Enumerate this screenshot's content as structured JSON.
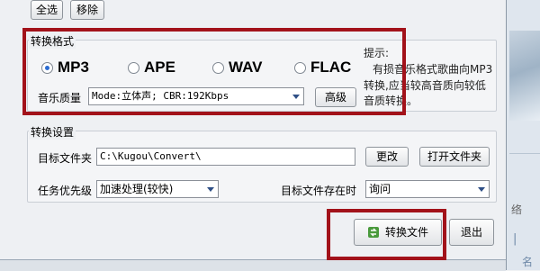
{
  "toolbar": {
    "select_all": "全选",
    "remove": "移除"
  },
  "format_section": {
    "title": "转换格式",
    "options": [
      {
        "label": "MP3",
        "checked": true
      },
      {
        "label": "APE",
        "checked": false
      },
      {
        "label": "WAV",
        "checked": false
      },
      {
        "label": "FLAC",
        "checked": false
      }
    ],
    "quality_label": "音乐质量",
    "quality_value": "Mode:立体声; CBR:192Kbps",
    "advanced_button": "高级",
    "hint_title": "提示:",
    "hint_line1": "有损音乐格式歌曲向MP3",
    "hint_line2": "转换,应当较高音质向较低",
    "hint_line3": "音质转换。"
  },
  "settings_section": {
    "title": "转换设置",
    "target_folder_label": "目标文件夹",
    "target_folder_value": "C:\\Kugou\\Convert\\",
    "change_button": "更改",
    "open_folder_button": "打开文件夹",
    "priority_label": "任务优先级",
    "priority_value": "加速处理(较快)",
    "exists_label": "目标文件存在时",
    "exists_value": "询问"
  },
  "actions": {
    "convert": "转换文件",
    "exit": "退出"
  },
  "background": {
    "text1": "络",
    "text2": "|",
    "text3": "名"
  },
  "colors": {
    "highlight": "#a2121a",
    "accent": "#2a6bd1"
  }
}
